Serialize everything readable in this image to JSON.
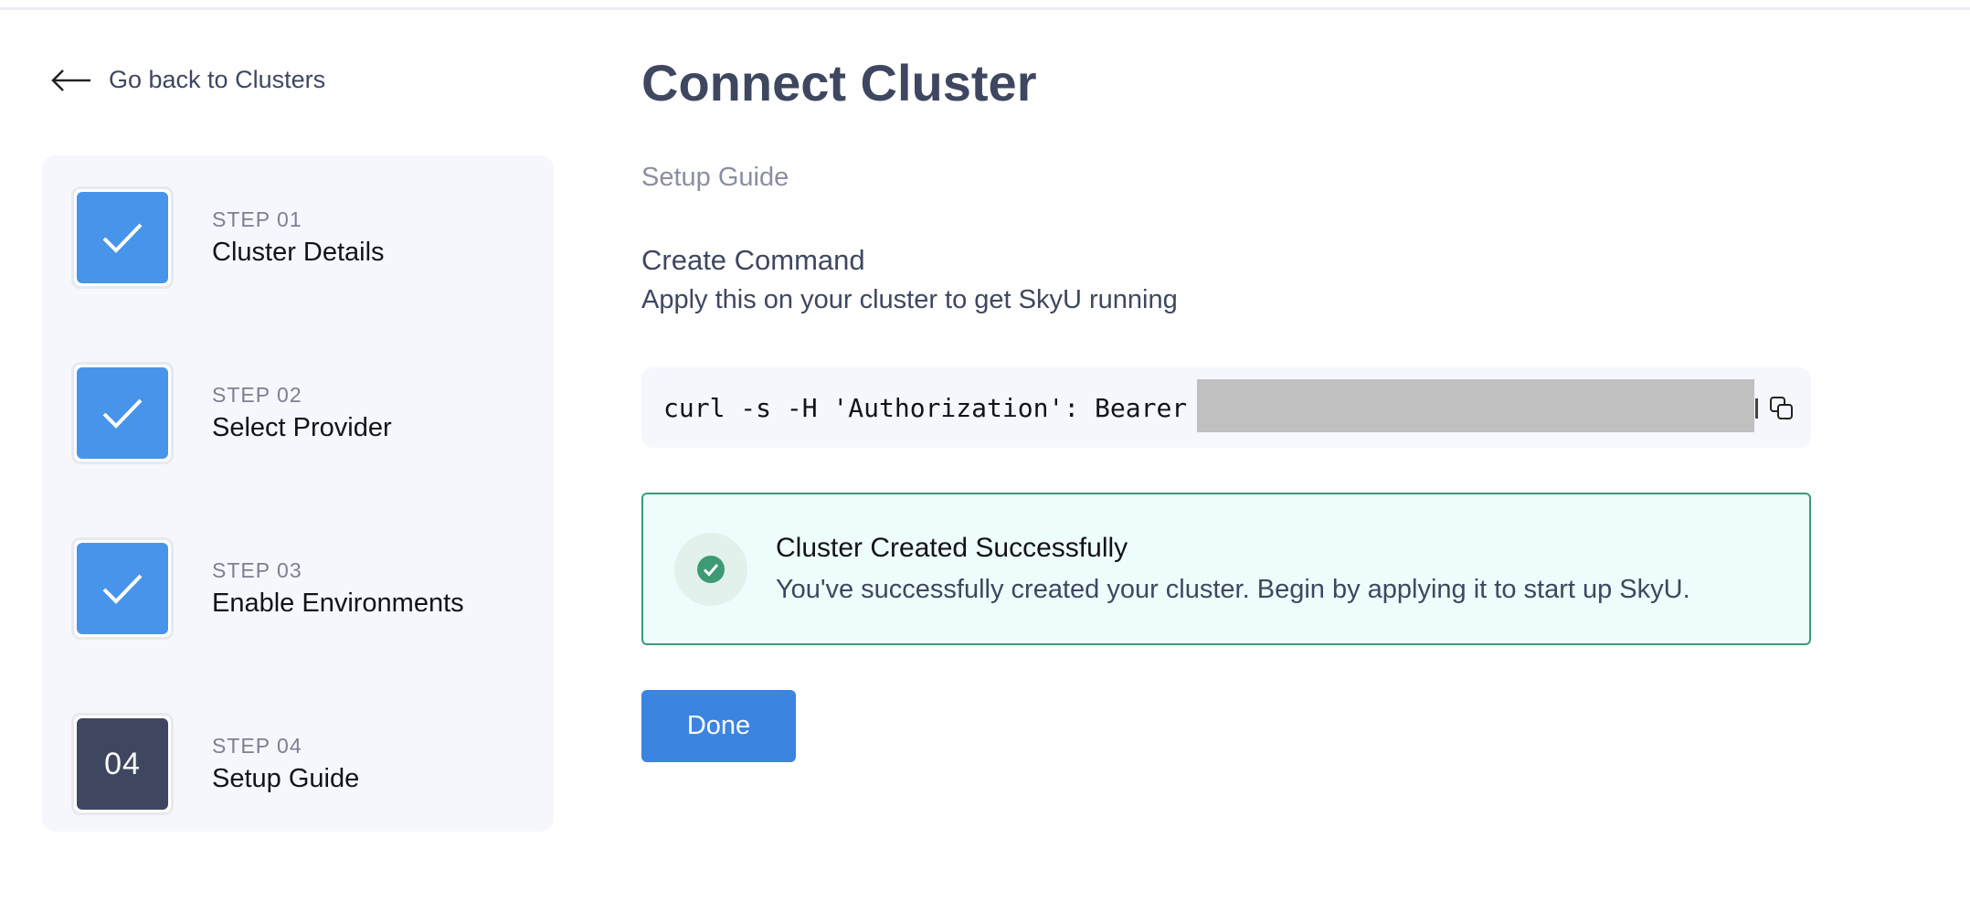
{
  "nav": {
    "back_label": "Go back to Clusters"
  },
  "steps": [
    {
      "number": "STEP 01",
      "title": "Cluster Details",
      "status": "done"
    },
    {
      "number": "STEP 02",
      "title": "Select Provider",
      "status": "done"
    },
    {
      "number": "STEP 03",
      "title": "Enable Environments",
      "status": "done"
    },
    {
      "number": "STEP 04",
      "title": "Setup Guide",
      "status": "current",
      "badge": "04"
    }
  ],
  "main": {
    "title": "Connect Cluster",
    "subtitle": "Setup Guide",
    "section_title": "Create Command",
    "section_desc": "Apply this on your cluster to get SkyU running",
    "command": "curl -s -H 'Authorization': Bearer",
    "success": {
      "title": "Cluster Created Successfully",
      "message": "You've successfully created your cluster. Begin by applying it to start up SkyU."
    },
    "done_label": "Done"
  },
  "colors": {
    "step_done": "#4894ea",
    "step_current": "#3f4760",
    "primary_button": "#3b84df",
    "success_border": "#3d9a74",
    "success_bg": "#eefdfb"
  }
}
